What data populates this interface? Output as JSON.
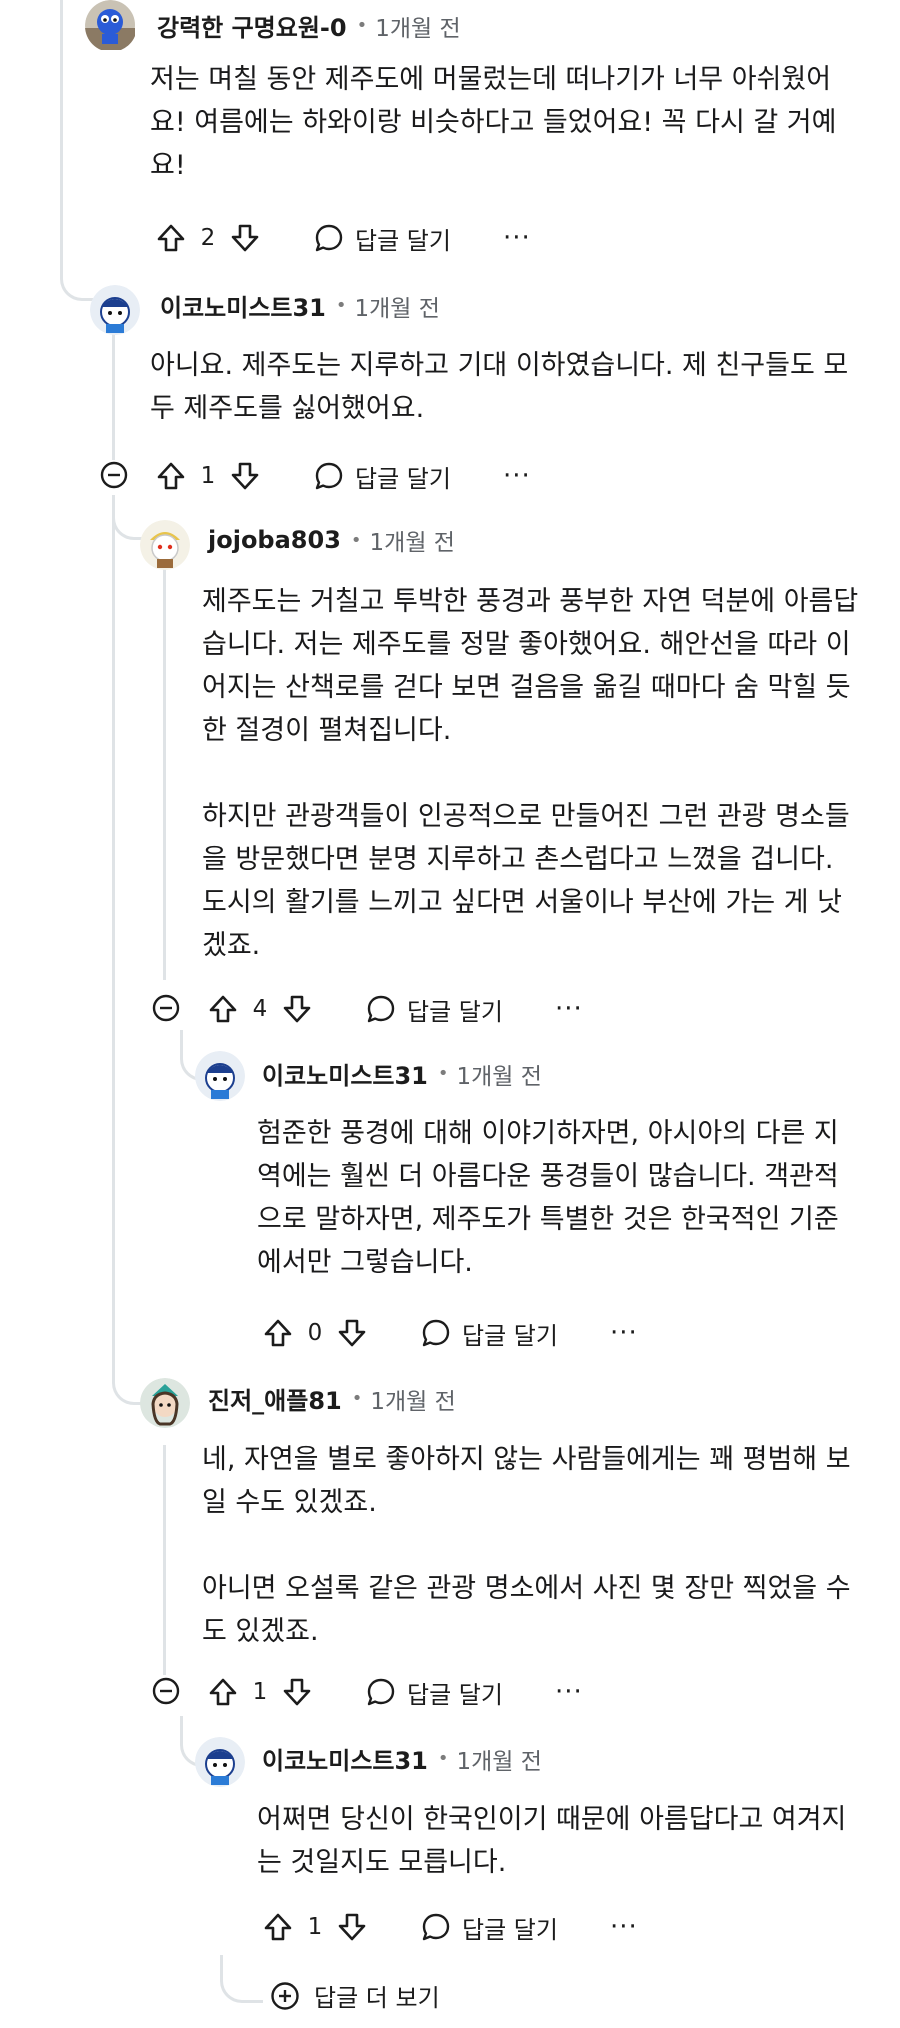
{
  "comments": [
    {
      "username": "강력한 구명요원-0",
      "separator": "•",
      "time": "1개월 전",
      "paragraphs": [
        "저는 며칠 동안 제주도에 머물렀는데 떠나기가 너무 아쉬웠어요! 여름에는 하와이랑 비슷하다고 들었어요! 꼭 다시 갈 거예요!"
      ],
      "votes": "2"
    },
    {
      "username": "이코노미스트31",
      "separator": "•",
      "time": "1개월 전",
      "paragraphs": [
        "아니요. 제주도는 지루하고 기대 이하였습니다. 제 친구들도 모두 제주도를 싫어했어요."
      ],
      "votes": "1"
    },
    {
      "username": "jojoba803",
      "separator": "•",
      "time": "1개월 전",
      "paragraphs": [
        "제주도는 거칠고 투박한 풍경과 풍부한 자연 덕분에 아름답습니다. 저는 제주도를 정말 좋아했어요. 해안선을 따라 이어지는 산책로를 걷다 보면 걸음을 옮길 때마다 숨 막힐 듯한 절경이 펼쳐집니다.",
        "하지만 관광객들이 인공적으로 만들어진 그런 관광 명소들을 방문했다면 분명 지루하고 촌스럽다고 느꼈을 겁니다. 도시의 활기를 느끼고 싶다면 서울이나 부산에 가는 게 낫겠죠."
      ],
      "votes": "4"
    },
    {
      "username": "이코노미스트31",
      "separator": "•",
      "time": "1개월 전",
      "paragraphs": [
        "험준한 풍경에 대해 이야기하자면, 아시아의 다른 지역에는 훨씬 더 아름다운 풍경들이 많습니다. 객관적으로 말하자면, 제주도가 특별한 것은 한국적인 기준에서만 그렇습니다."
      ],
      "votes": "0"
    },
    {
      "username": "진저_애플81",
      "separator": "•",
      "time": "1개월 전",
      "paragraphs": [
        "네, 자연을 별로 좋아하지 않는 사람들에게는 꽤 평범해 보일 수도 있겠죠.",
        "아니면 오설록 같은 관광 명소에서 사진 몇 장만 찍었을 수도 있겠죠."
      ],
      "votes": "1"
    },
    {
      "username": "이코노미스트31",
      "separator": "•",
      "time": "1개월 전",
      "paragraphs": [
        "어쩌면 당신이 한국인이기 때문에 아름답다고 여겨지는 것일지도 모릅니다."
      ],
      "votes": "1"
    }
  ],
  "actions": {
    "reply_label": "답글 달기",
    "more_label": "···"
  },
  "icons": {
    "upvote": "arrow-up-icon",
    "downvote": "arrow-down-icon",
    "reply": "speech-bubble-icon",
    "collapse": "minus-circle-icon",
    "expand": "plus-circle-icon"
  },
  "footer": {
    "more_replies_label": "답글 더 보기"
  },
  "colors": {
    "thread_line": "#dfe3e6",
    "text": "#1a1a1b",
    "meta": "#5f6368"
  }
}
